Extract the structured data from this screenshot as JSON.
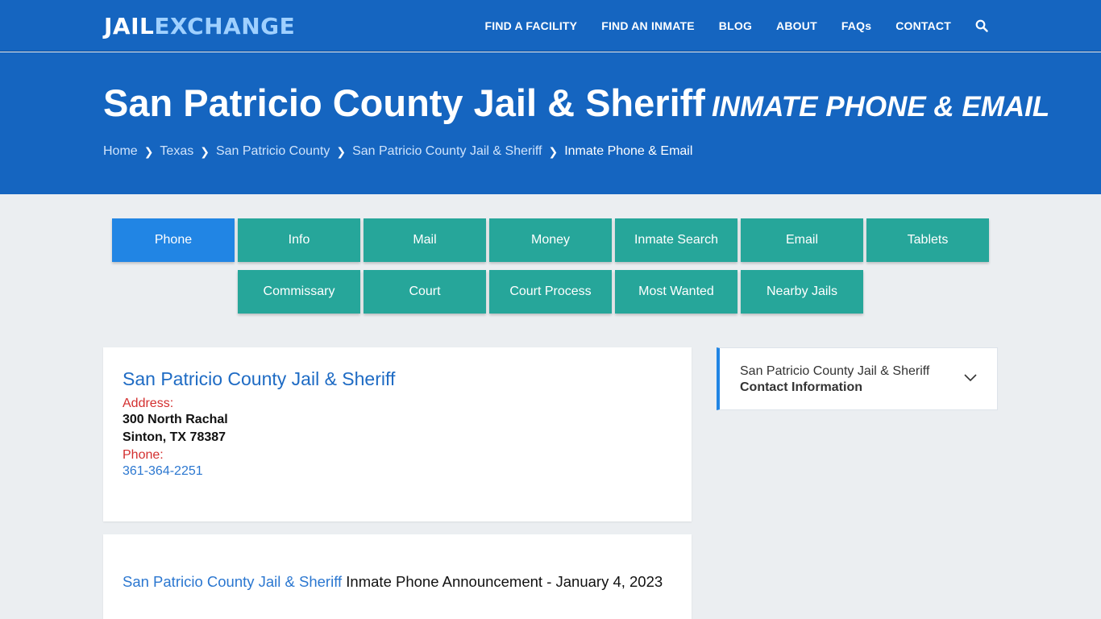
{
  "header": {
    "logo_part1": "JAIL",
    "logo_part2": "EXCHANGE",
    "nav": [
      "FIND A FACILITY",
      "FIND AN INMATE",
      "BLOG",
      "ABOUT",
      "FAQs",
      "CONTACT"
    ],
    "search_icon": "search-icon"
  },
  "hero": {
    "title": "San Patricio County Jail & Sheriff",
    "subtitle": "INMATE PHONE & EMAIL",
    "breadcrumbs": [
      "Home",
      "Texas",
      "San Patricio County",
      "San Patricio County Jail & Sheriff"
    ],
    "current": "Inmate Phone & Email"
  },
  "tabs": {
    "row1": [
      "Phone",
      "Info",
      "Mail",
      "Money",
      "Inmate Search",
      "Email",
      "Tablets"
    ],
    "row2": [
      "Commissary",
      "Court",
      "Court Process",
      "Most Wanted",
      "Nearby Jails"
    ],
    "active": "Phone"
  },
  "facility_card": {
    "name": "San Patricio County Jail & Sheriff",
    "address_label": "Address:",
    "address_line1": "300 North Rachal",
    "address_line2": "Sinton, TX 78387",
    "phone_label": "Phone:",
    "phone": "361-364-2251"
  },
  "announcement": {
    "link": "San Patricio County Jail & Sheriff",
    "text": " Inmate Phone Announcement - January 4, 2023"
  },
  "sidebar": {
    "line1": "San Patricio County Jail & Sheriff",
    "line2": "Contact Information"
  },
  "colors": {
    "header_blue": "#1565c0",
    "tab_teal": "#26a69a",
    "tab_active": "#2185e4",
    "label_red": "#d32f2f",
    "link_blue": "#2b77d0"
  }
}
